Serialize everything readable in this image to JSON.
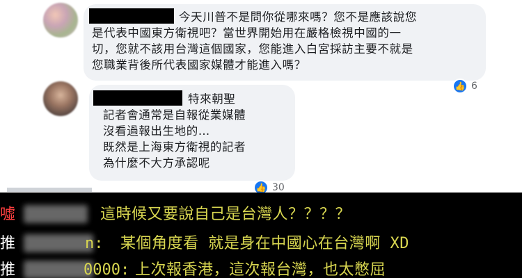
{
  "comments": [
    {
      "author_redacted": true,
      "lines": [
        "今天川普不是問你從哪來嗎？您不是應該說您",
        "是代表中國東方衛視吧？當世界開始用在嚴格檢視中國的一",
        "切，您就不該用台灣這個國家，您能進入白宮採訪主要不就是",
        "您職業背後所代表國家媒體才能進入嗎？"
      ],
      "reaction": {
        "icon": "like-icon",
        "count": "6"
      }
    },
    {
      "author_redacted": true,
      "author_suffix": "特來朝聖",
      "lines": [
        "記者會通常是自報從業媒體",
        "沒看過報出生地的…",
        "既然是上海東方衛視的記者",
        "為什麼不大方承認呢"
      ],
      "reaction": {
        "icon": "like-icon",
        "count": "30"
      }
    }
  ],
  "ptt_pushes": [
    {
      "tag": "噓",
      "tag_color": "#ff4040",
      "user_visible": "",
      "text": "這時候又要說自己是台灣人？？？？"
    },
    {
      "tag": "推",
      "tag_color": "#ffffff",
      "user_visible": "n:",
      "text": "某個角度看 就是身在中國心在台灣啊 XD"
    },
    {
      "tag": "推",
      "tag_color": "#ffffff",
      "user_visible": "0000:",
      "text": "上次報香港，這次報台灣，也太憋屈"
    }
  ],
  "colors": {
    "bubble_bg": "#f0f2f5",
    "like_blue": "#1877f2",
    "ptt_bg": "#000000",
    "ptt_text": "#d8d650"
  }
}
